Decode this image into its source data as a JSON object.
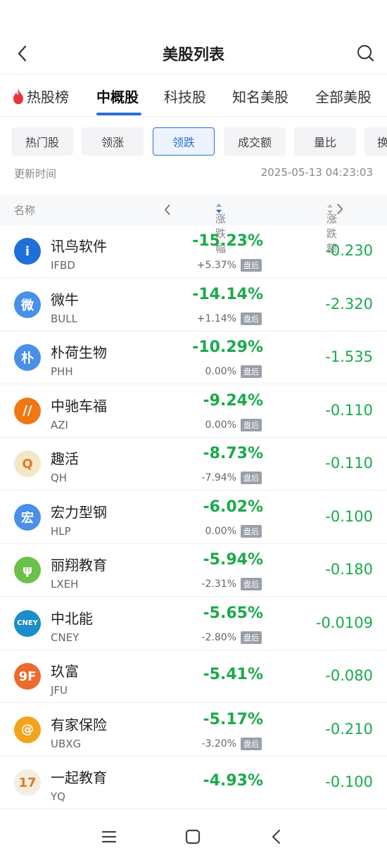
{
  "header": {
    "title": "美股列表"
  },
  "tabs": [
    {
      "label": "热股榜"
    },
    {
      "label": "中概股"
    },
    {
      "label": "科技股"
    },
    {
      "label": "知名美股"
    },
    {
      "label": "全部美股"
    }
  ],
  "filters": [
    "热门股",
    "领涨",
    "领跌",
    "成交额",
    "量比",
    "换"
  ],
  "update": {
    "label": "更新时间",
    "time": "2025-05-13 04:23:03"
  },
  "columns": {
    "name": "名称",
    "change_pct": "涨跌幅",
    "change_amt": "涨跌额"
  },
  "after_label": "盘后",
  "stocks": [
    {
      "name": "讯鸟软件",
      "code": "IFBD",
      "pct": "-15.23%",
      "after": "+5.37%",
      "amt": "-0.230",
      "logo": "i",
      "color": "#1e6fd9"
    },
    {
      "name": "微牛",
      "code": "BULL",
      "pct": "-14.14%",
      "after": "+1.14%",
      "amt": "-2.320",
      "logo": "微",
      "color": "#4a8fe8"
    },
    {
      "name": "朴荷生物",
      "code": "PHH",
      "pct": "-10.29%",
      "after": "0.00%",
      "amt": "-1.535",
      "logo": "朴",
      "color": "#4a8fe8"
    },
    {
      "name": "中驰车福",
      "code": "AZI",
      "pct": "-9.24%",
      "after": "0.00%",
      "amt": "-0.110",
      "logo": "//",
      "color": "#f07814"
    },
    {
      "name": "趣活",
      "code": "QH",
      "pct": "-8.73%",
      "after": "-7.94%",
      "amt": "-0.110",
      "logo": "Q",
      "color": "#f4e7c8"
    },
    {
      "name": "宏力型钢",
      "code": "HLP",
      "pct": "-6.02%",
      "after": "0.00%",
      "amt": "-0.100",
      "logo": "宏",
      "color": "#4a8fe8"
    },
    {
      "name": "丽翔教育",
      "code": "LXEH",
      "pct": "-5.94%",
      "after": "-2.31%",
      "amt": "-0.180",
      "logo": "ψ",
      "color": "#6cc04a"
    },
    {
      "name": "中北能",
      "code": "CNEY",
      "pct": "-5.65%",
      "after": "-2.80%",
      "amt": "-0.0109",
      "logo": "CNEY",
      "color": "#1a8ec8"
    },
    {
      "name": "玖富",
      "code": "JFU",
      "pct": "-5.41%",
      "after": "",
      "amt": "-0.080",
      "logo": "9F",
      "color": "#ee6a2a"
    },
    {
      "name": "有家保险",
      "code": "UBXG",
      "pct": "-5.17%",
      "after": "-3.20%",
      "amt": "-0.210",
      "logo": "@",
      "color": "#f2a41c"
    },
    {
      "name": "一起教育",
      "code": "YQ",
      "pct": "-4.93%",
      "after": "",
      "amt": "-0.100",
      "logo": "17",
      "color": "#f4ede2"
    }
  ]
}
